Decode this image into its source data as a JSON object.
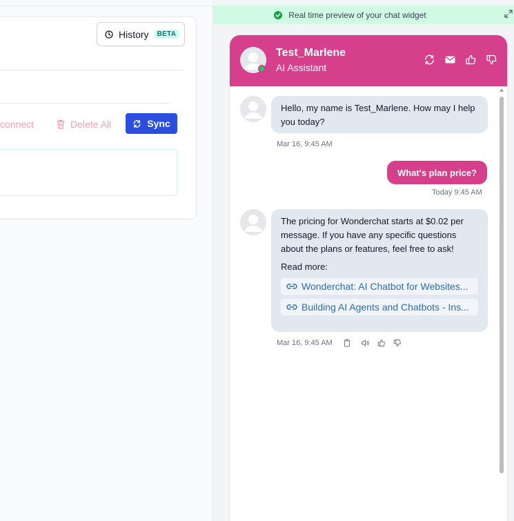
{
  "left": {
    "history_label": "History",
    "beta_badge": "BETA",
    "connect_label": "connect",
    "delete_all_label": "Delete All",
    "sync_label": "Sync"
  },
  "preview": {
    "banner_text": "Real time preview of your chat widget"
  },
  "widget": {
    "bot_name": "Test_Marlene",
    "bot_role": "AI Assistant",
    "colors": {
      "accent": "#d63f8c",
      "bubble": "#e2e8f0",
      "online": "#22c55e",
      "link": "#2b6cb0"
    },
    "messages": [
      {
        "from": "bot",
        "text": "Hello, my name is Test_Marlene. How may I help you today?",
        "time": "Mar 16, 9:45 AM"
      },
      {
        "from": "user",
        "text": "What's plan price?",
        "time": "Today 9:45 AM"
      },
      {
        "from": "bot",
        "text": "The pricing for Wonderchat starts at $0.02 per message. If you have any specific questions about the plans or features, feel free to ask!",
        "read_more": "Read more:",
        "links": [
          "Wonderchat: AI Chatbot for Websites...",
          "Building AI Agents and Chatbots - Ins..."
        ],
        "time": "Mar 16, 9:45 AM"
      }
    ]
  }
}
